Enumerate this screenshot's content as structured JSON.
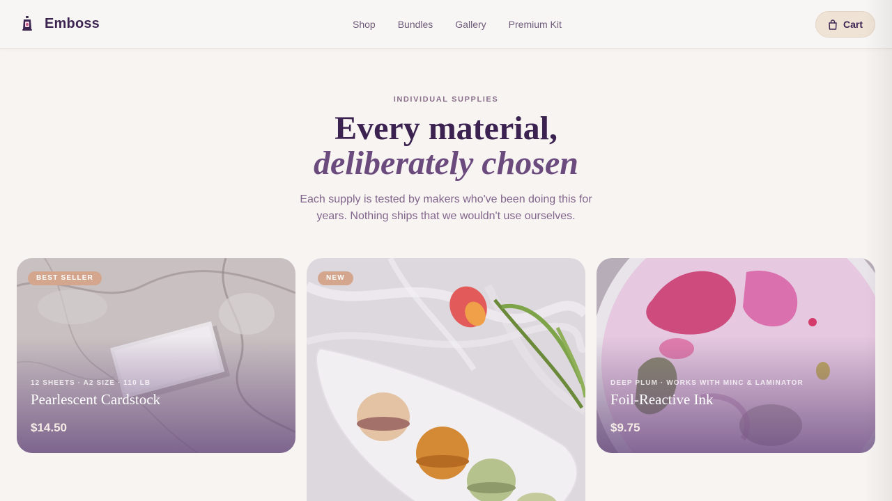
{
  "header": {
    "brand": "Emboss",
    "nav": [
      "Shop",
      "Bundles",
      "Gallery",
      "Premium Kit"
    ],
    "cart_label": "Cart",
    "icons": {
      "logo": "lantern-logo-icon",
      "cart": "shopping-bag-icon"
    }
  },
  "hero": {
    "eyebrow": "INDIVIDUAL SUPPLIES",
    "headline_line1": "Every material,",
    "headline_line2": "deliberately chosen",
    "subtitle": "Each supply is tested by makers who've been doing this for years. Nothing ships that we wouldn't use ourselves."
  },
  "products": [
    {
      "badge": "BEST SELLER",
      "meta": "12 SHEETS · A2 SIZE · 110 LB",
      "name": "Pearlescent Cardstock",
      "price": "$14.50"
    },
    {
      "badge": "NEW",
      "meta": "",
      "name": "",
      "price": ""
    },
    {
      "badge": "",
      "meta": "DEEP PLUM · WORKS WITH MINC & LAMINATOR",
      "name": "Foil-Reactive Ink",
      "price": "$9.75"
    }
  ],
  "colors": {
    "background": "#f7f4f1",
    "brand_text": "#3d2552",
    "accent_badge": "#d4a68d",
    "cart_button": "#efe3d6",
    "headline_italic": "#6b4a7e"
  }
}
